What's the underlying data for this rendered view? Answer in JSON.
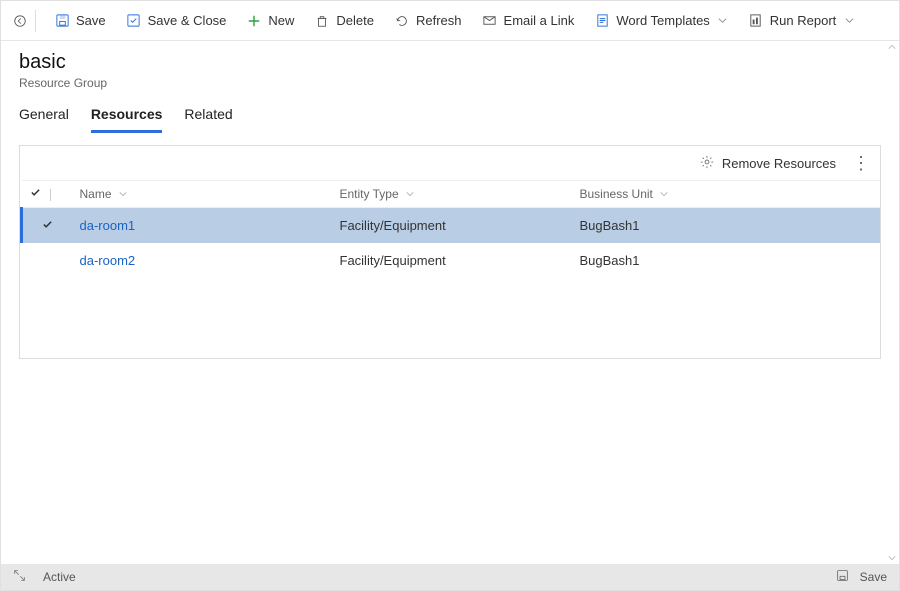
{
  "toolbar": {
    "save": "Save",
    "save_close": "Save & Close",
    "new": "New",
    "delete": "Delete",
    "refresh": "Refresh",
    "email": "Email a Link",
    "word_templates": "Word Templates",
    "run_report": "Run Report"
  },
  "header": {
    "title": "basic",
    "subtitle": "Resource Group"
  },
  "tabs": {
    "general": "General",
    "resources": "Resources",
    "related": "Related"
  },
  "panel": {
    "remove_resources": "Remove Resources",
    "columns": {
      "name": "Name",
      "entity_type": "Entity Type",
      "business_unit": "Business Unit"
    },
    "rows": [
      {
        "name": "da-room1",
        "entity_type": "Facility/Equipment",
        "business_unit": "BugBash1",
        "selected": true
      },
      {
        "name": "da-room2",
        "entity_type": "Facility/Equipment",
        "business_unit": "BugBash1",
        "selected": false
      }
    ]
  },
  "statusbar": {
    "status": "Active",
    "save": "Save"
  }
}
